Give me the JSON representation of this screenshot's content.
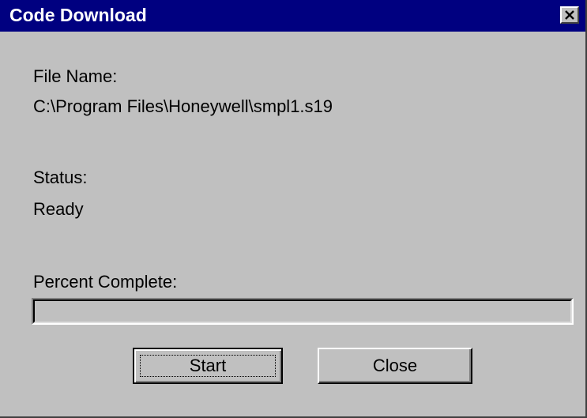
{
  "window": {
    "title": "Code Download",
    "close_icon": "close-x-icon",
    "title_bar_color": "#000080",
    "body_color": "#c0c0c0"
  },
  "fields": {
    "file_name_label": "File Name:",
    "file_name_value": "C:\\Program Files\\Honeywell\\smpl1.s19",
    "status_label": "Status:",
    "status_value": "Ready",
    "percent_label": "Percent Complete:",
    "percent_complete": 0
  },
  "buttons": {
    "start_label": "Start",
    "close_label": "Close"
  }
}
